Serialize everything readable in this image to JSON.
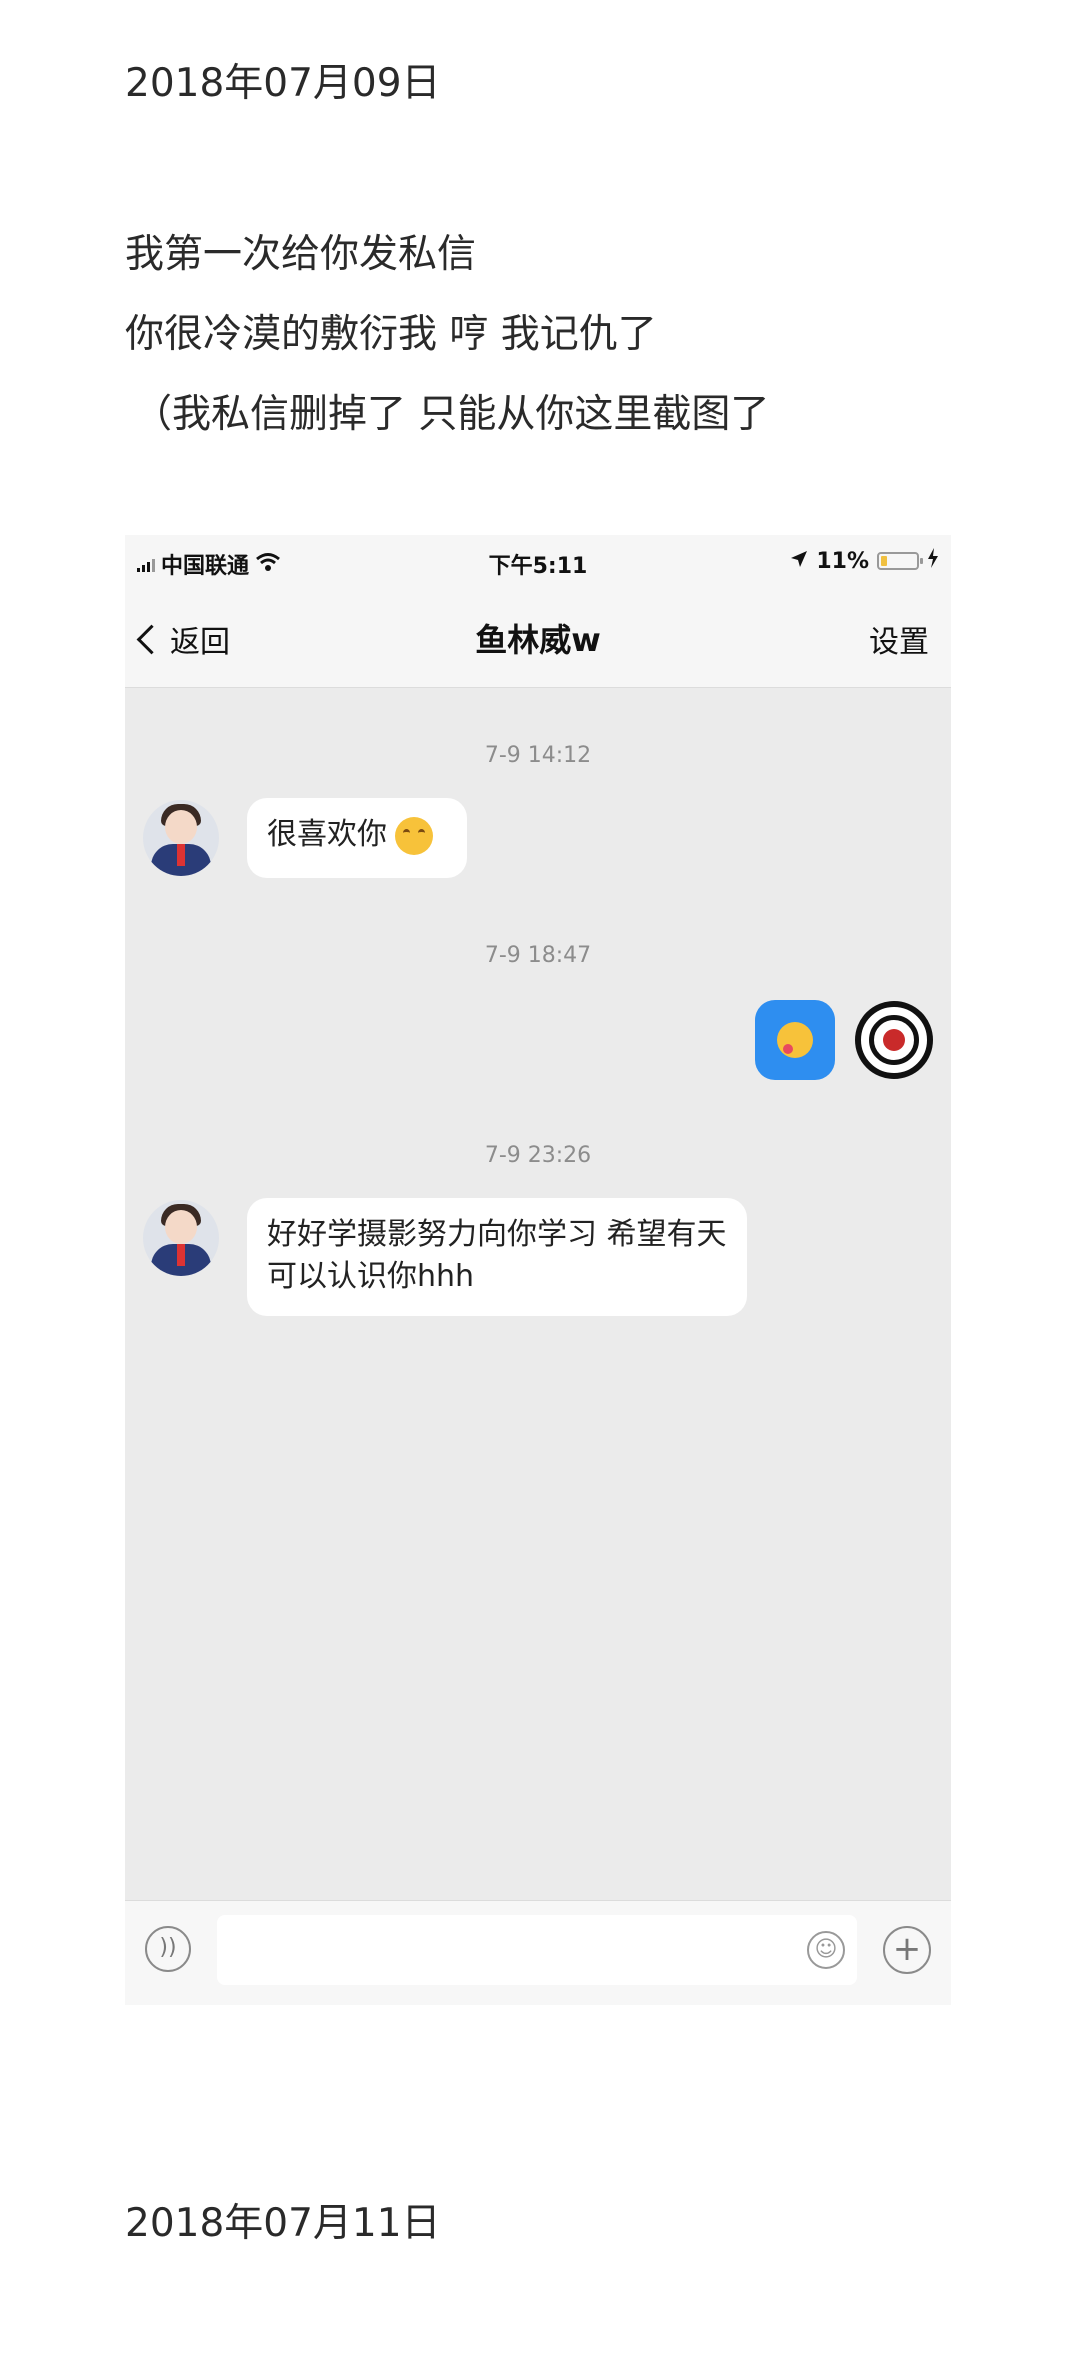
{
  "post": {
    "date1": "2018年07月09日",
    "lines": [
      "我第一次给你发私信",
      "你很冷漠的敷衍我 哼 我记仇了",
      "（我私信删掉了 只能从你这里截图了"
    ],
    "date2": "2018年07月11日"
  },
  "screenshot": {
    "status": {
      "carrier": "中国联通",
      "time": "下午5:11",
      "battery": "11%"
    },
    "nav": {
      "back": "返回",
      "title": "鱼林威w",
      "settings": "设置"
    },
    "messages": [
      {
        "time": "7-9 14:12",
        "from": "them",
        "text": "很喜欢你"
      },
      {
        "time": "7-9 18:47",
        "from": "me",
        "text": ""
      },
      {
        "time": "7-9 23:26",
        "from": "them",
        "text": "好好学摄影努力向你学习 希望有天可以认识你hhh"
      }
    ]
  }
}
